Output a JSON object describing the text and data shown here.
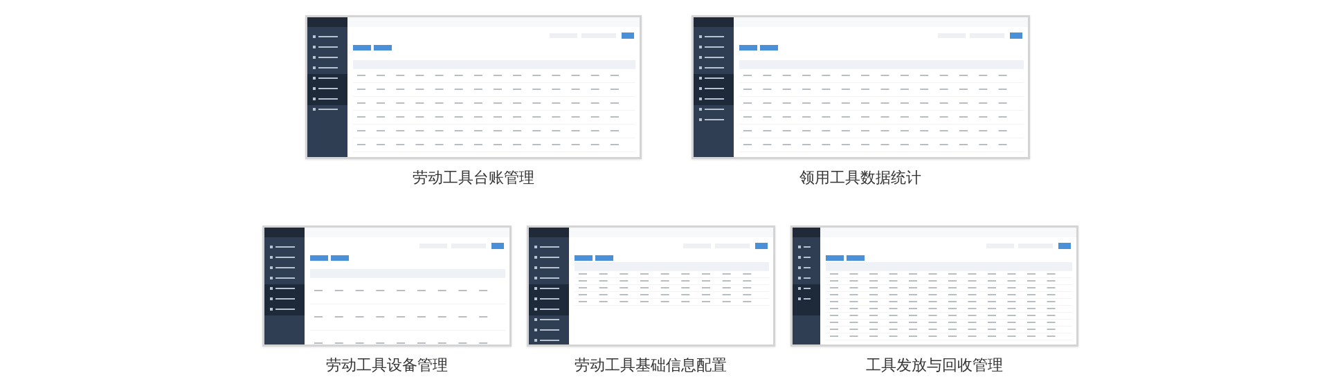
{
  "rows": [
    {
      "items": [
        {
          "kind": "picture",
          "caption": "劳动工具台账管理"
        },
        {
          "kind": "picture",
          "caption": "领用工具数据统计"
        }
      ]
    },
    {
      "items": [
        {
          "kind": "picture",
          "caption": "劳动工具设备管理"
        },
        {
          "kind": "picture",
          "caption": "劳动工具基础信息配置"
        },
        {
          "kind": "picture",
          "caption": "工具发放与回收管理"
        }
      ]
    }
  ]
}
